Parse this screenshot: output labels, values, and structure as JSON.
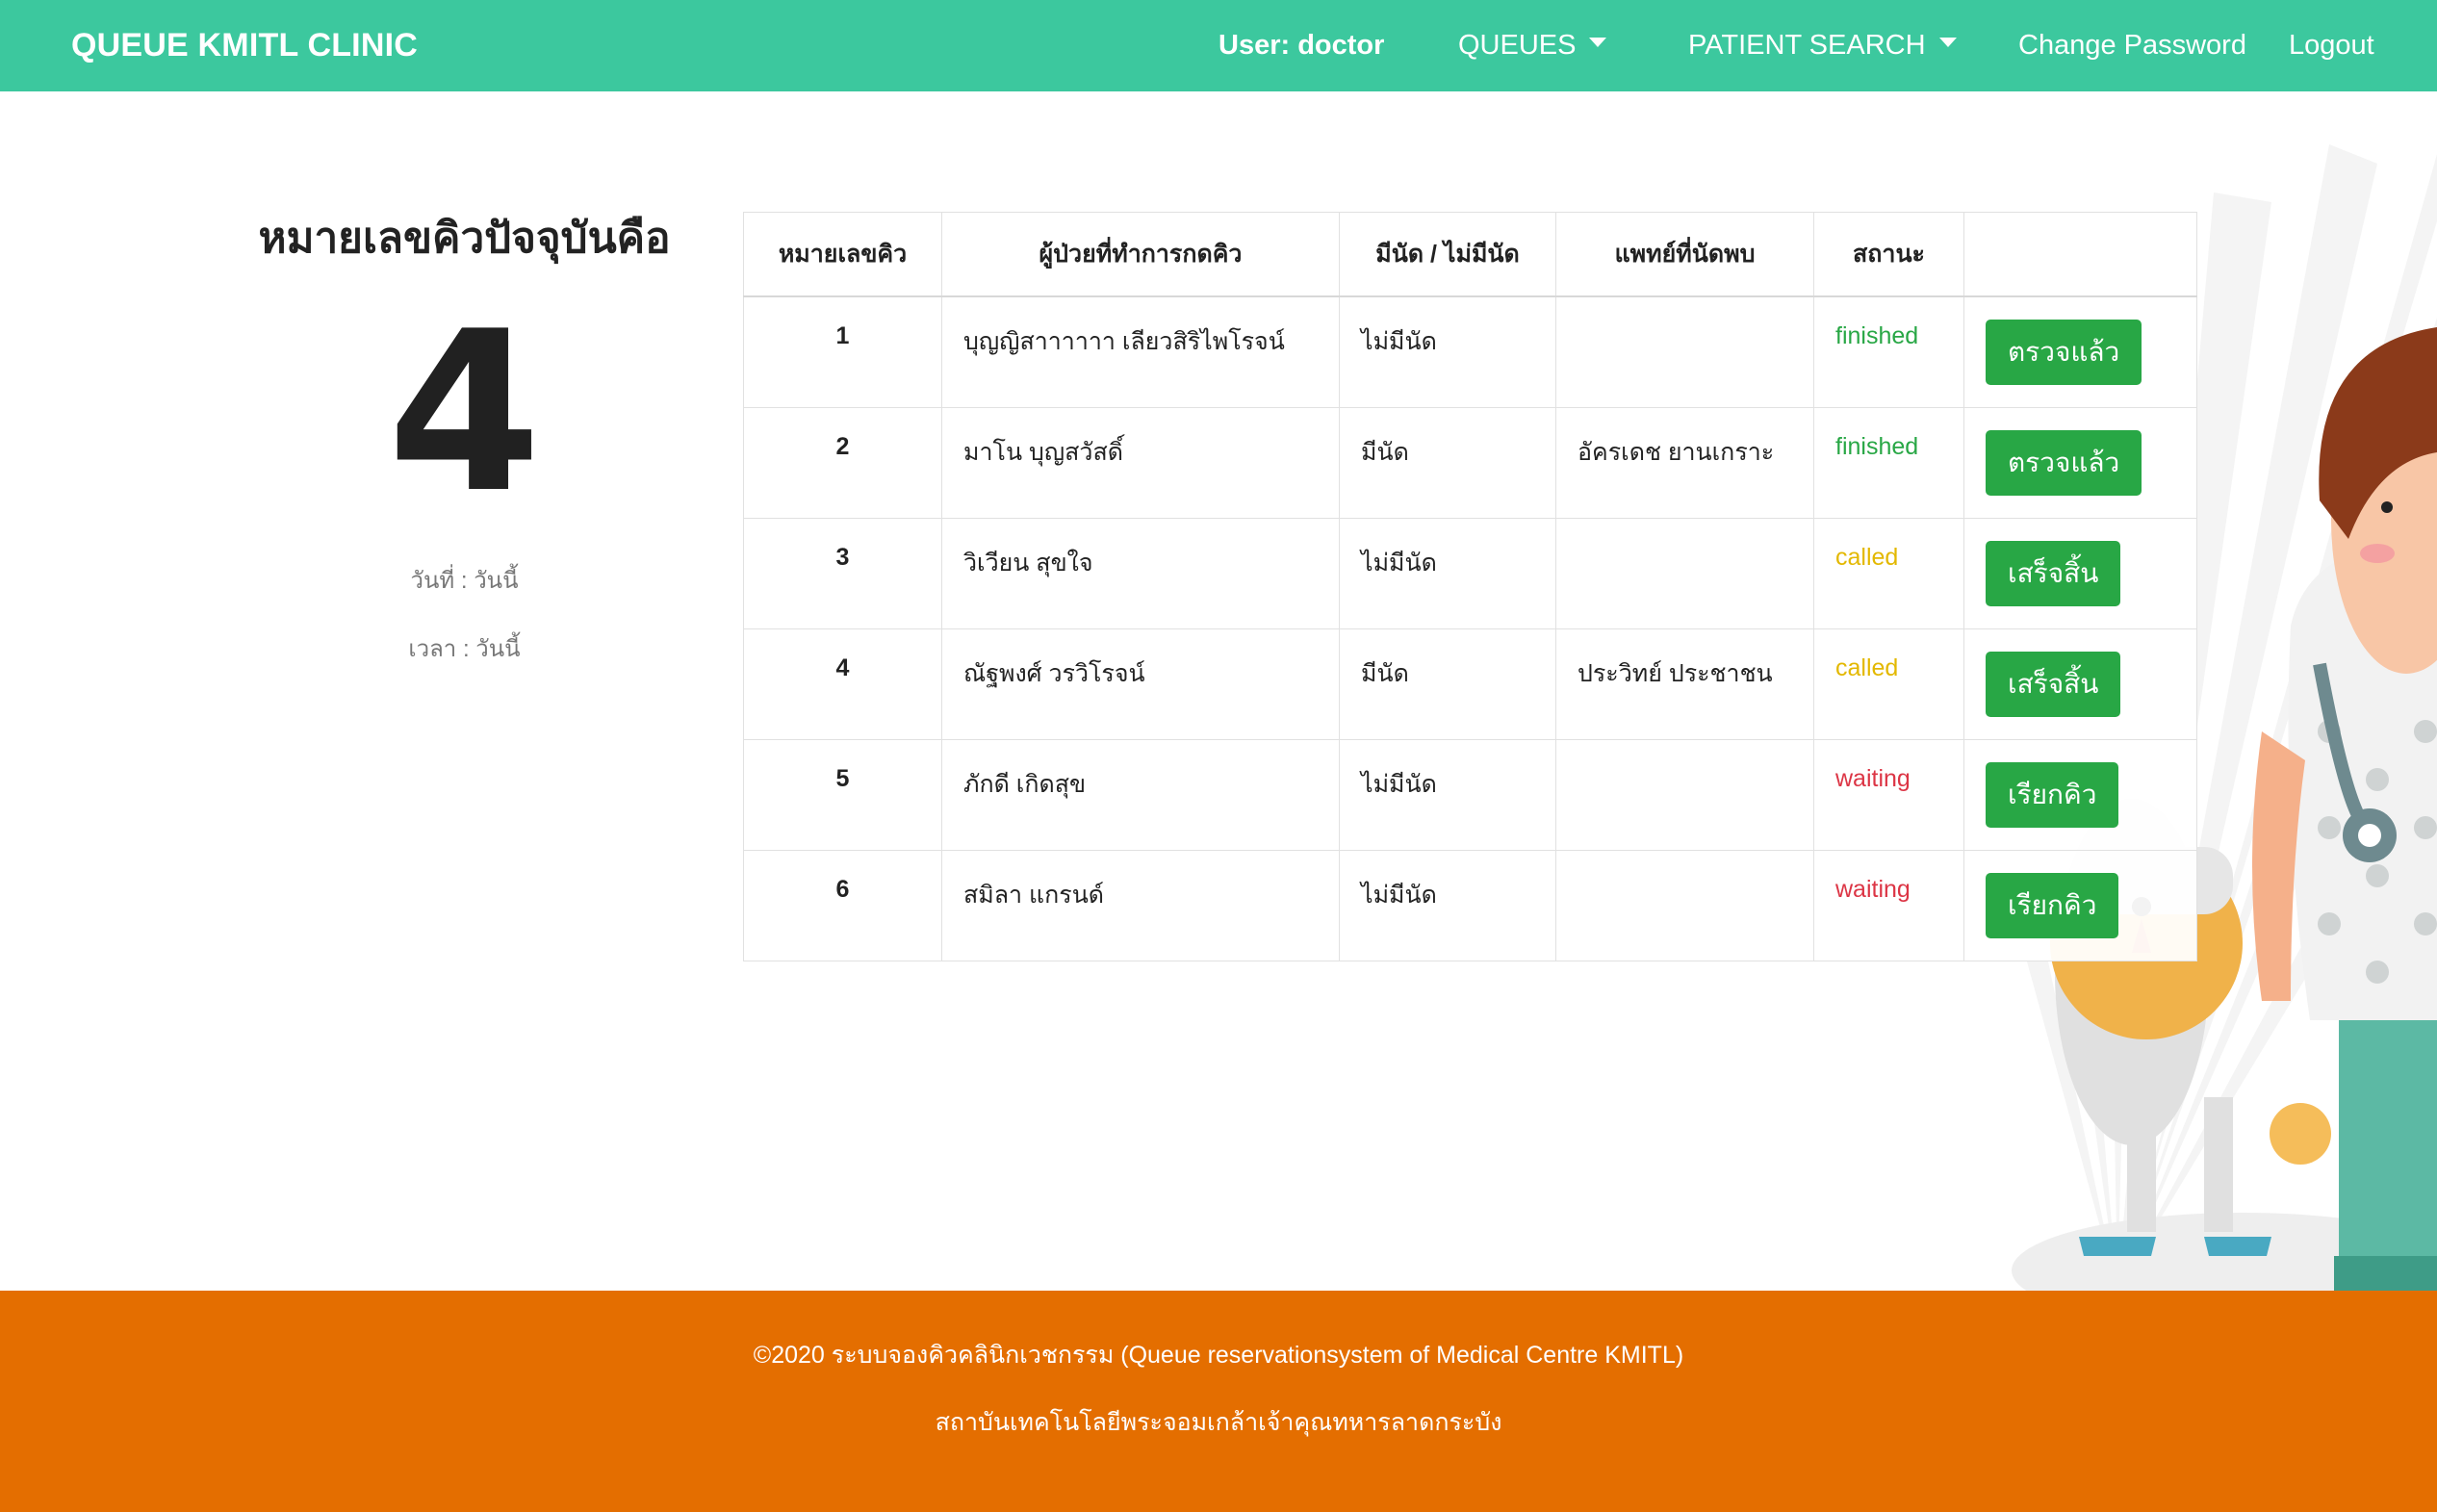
{
  "navbar": {
    "brand": "QUEUE KMITL CLINIC",
    "user": "User: doctor",
    "queues": "QUEUES",
    "patient_search": "PATIENT SEARCH",
    "change_password": "Change Password",
    "logout": "Logout"
  },
  "current": {
    "heading": "หมายเลขคิวปัจจุบันคือ",
    "number": "4",
    "date": "วันที่ : วันนี้",
    "time": "เวลา : วันนี้"
  },
  "table": {
    "headers": [
      "หมายเลขคิว",
      "ผู้ป่วยที่ทำการกดคิว",
      "มีนัด / ไม่มีนัด",
      "แพทย์ที่นัดพบ",
      "สถานะ",
      ""
    ],
    "rows": [
      {
        "num": "1",
        "patient": "บุญญิสาาาาาา เลียวสิริไพโรจน์",
        "appt": "ไม่มีนัด",
        "doctor": "",
        "status": "finished",
        "action": "ตรวจแล้ว"
      },
      {
        "num": "2",
        "patient": "มาโน บุญสวัสดิ์",
        "appt": "มีนัด",
        "doctor": "อัครเดช ยานเกราะ",
        "status": "finished",
        "action": "ตรวจแล้ว"
      },
      {
        "num": "3",
        "patient": "วิเวียน สุขใจ",
        "appt": "ไม่มีนัด",
        "doctor": "",
        "status": "called",
        "action": "เสร็จสิ้น"
      },
      {
        "num": "4",
        "patient": "ณัฐพงศ์ วรวิโรจน์",
        "appt": "มีนัด",
        "doctor": "ประวิทย์ ประชาชน",
        "status": "called",
        "action": "เสร็จสิ้น"
      },
      {
        "num": "5",
        "patient": "ภักดี เกิดสุข",
        "appt": "ไม่มีนัด",
        "doctor": "",
        "status": "waiting",
        "action": "เรียกคิว"
      },
      {
        "num": "6",
        "patient": "สมิลา แกรนด์",
        "appt": "ไม่มีนัด",
        "doctor": "",
        "status": "waiting",
        "action": "เรียกคิว"
      }
    ]
  },
  "footer": {
    "copyright": "©2020 ระบบจองคิวคลินิกเวชกรรม (Queue reservationsystem of Medical Centre KMITL)",
    "institute": "สถาบันเทคโนโลยีพระจอมเกล้าเจ้าคุณทหารลาดกระบัง"
  },
  "colors": {
    "navbar": "#3cc89e",
    "footer": "#e46e00",
    "button": "#28a745",
    "finished": "#28a745",
    "called": "#e3b800",
    "waiting": "#dc3545"
  }
}
